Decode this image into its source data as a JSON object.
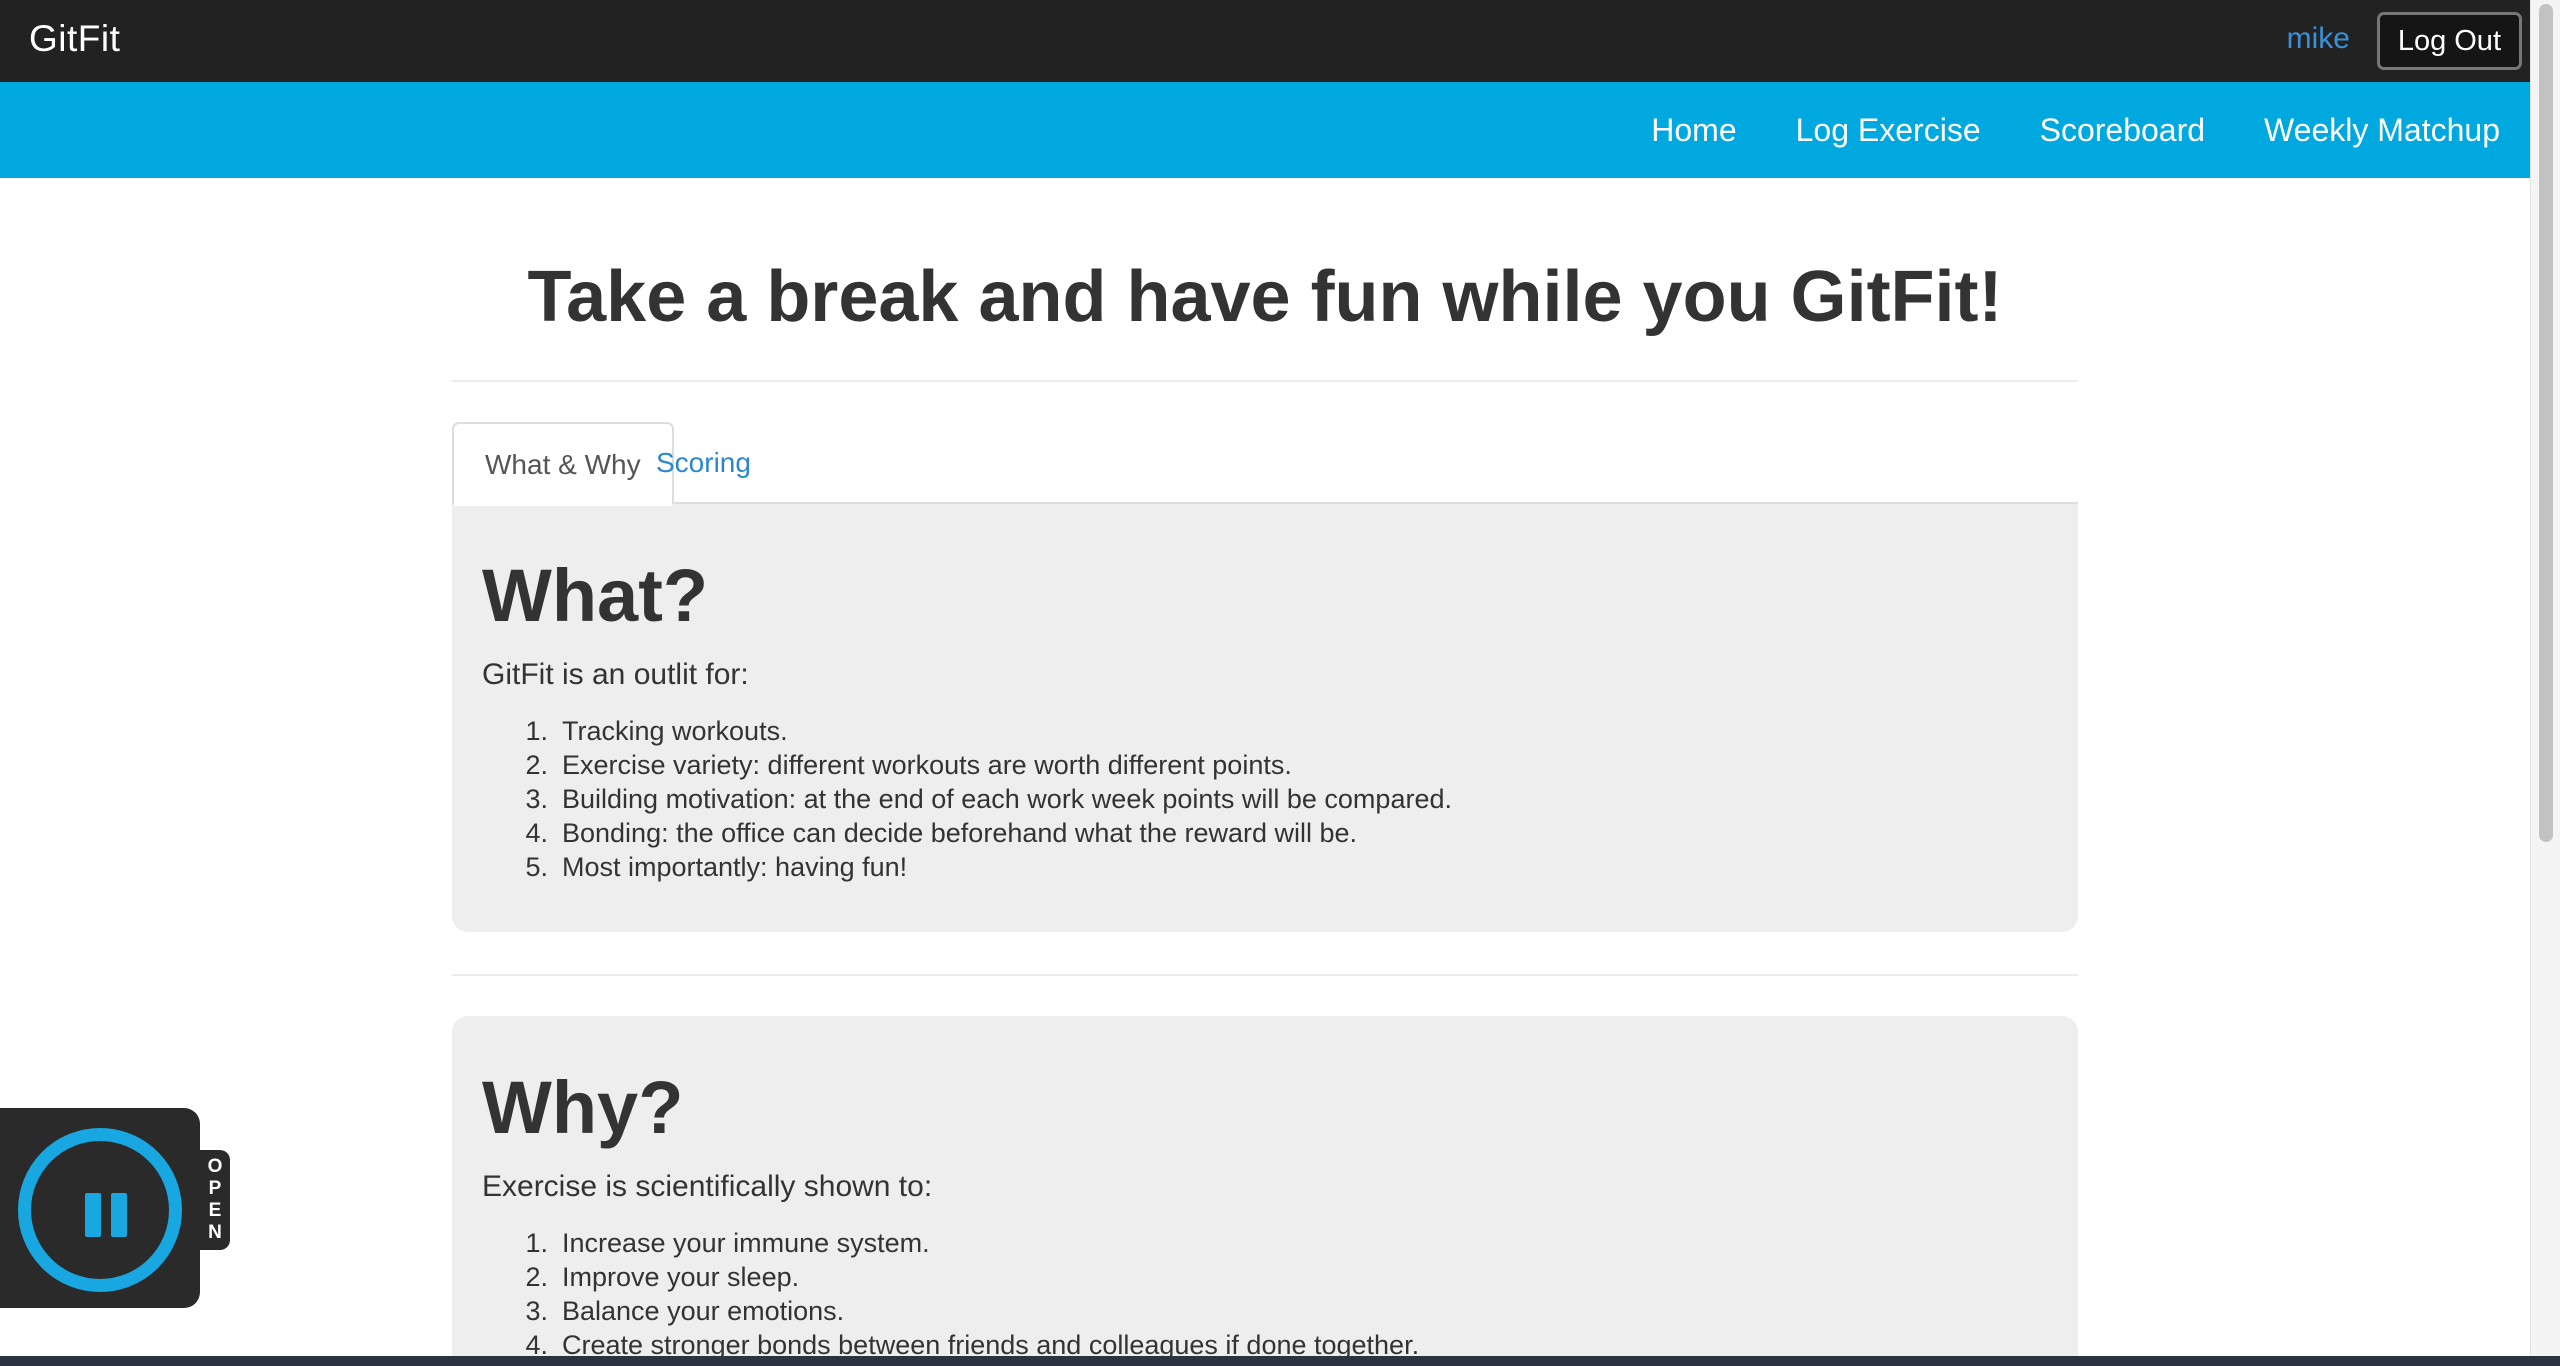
{
  "app": {
    "brand": "GitFit",
    "user": "mike",
    "logout_label": "Log Out"
  },
  "nav": {
    "items": [
      {
        "label": "Home"
      },
      {
        "label": "Log Exercise"
      },
      {
        "label": "Scoreboard"
      },
      {
        "label": "Weekly Matchup"
      }
    ]
  },
  "main": {
    "title": "Take a break and have fun while you GitFit!",
    "tabs": [
      {
        "label": "What & Why",
        "active": true
      },
      {
        "label": "Scoring",
        "active": false
      }
    ],
    "what": {
      "heading": "What?",
      "lead": "GitFit is an outlit for:",
      "items": [
        "Tracking workouts.",
        "Exercise variety: different workouts are worth different points.",
        "Building motivation: at the end of each work week points will be compared.",
        "Bonding: the office can decide beforehand what the reward will be.",
        "Most importantly: having fun!"
      ]
    },
    "why": {
      "heading": "Why?",
      "lead": "Exercise is scientifically shown to:",
      "items": [
        "Increase your immune system.",
        "Improve your sleep.",
        "Balance your emotions.",
        "Create stronger bonds between friends and colleagues if done together."
      ]
    }
  },
  "recorder": {
    "open_label": "OPEN",
    "state_icon": "pause-icon"
  },
  "colors": {
    "topbar": "#222222",
    "navbar": "#00a8e0",
    "link": "#2d87cc",
    "well": "#eeeeee",
    "recorder_accent": "#18a7e0"
  }
}
